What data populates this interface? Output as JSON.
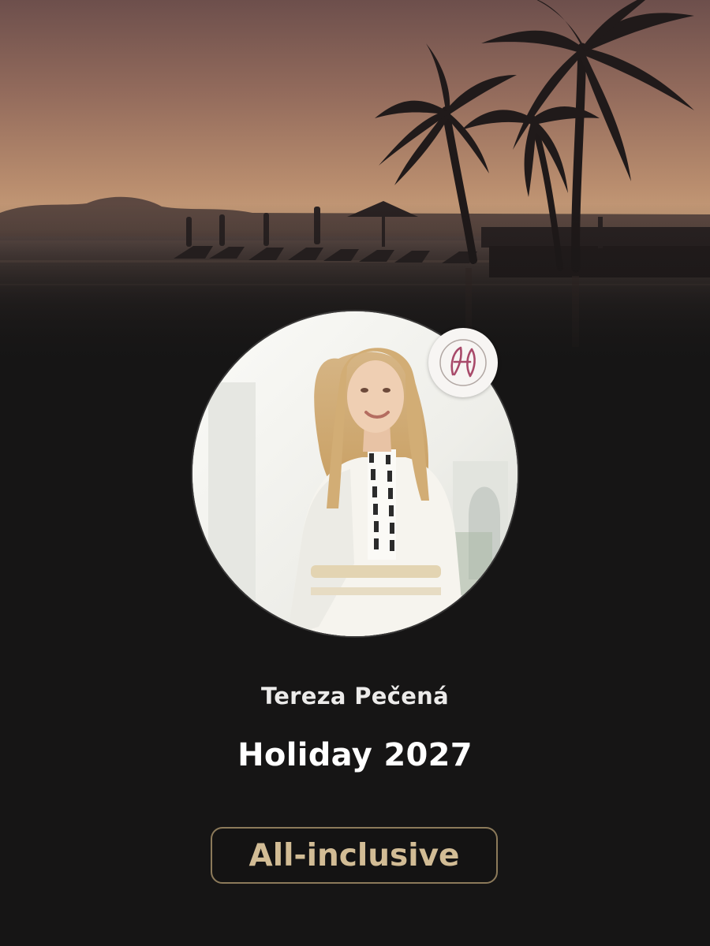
{
  "profile": {
    "name": "Tereza Pečená",
    "avatar_icon": "person-portrait-icon",
    "logo_icon": "monogram-logo-icon"
  },
  "event": {
    "title": "Holiday 2027",
    "badge": "All-inclusive"
  },
  "colors": {
    "background": "#161515",
    "accent_gold": "#d2bc95",
    "pill_border": "#8c7a5a",
    "text_primary": "#ffffff",
    "text_secondary": "#ecebea"
  },
  "cover": {
    "scene": "tropical-sunset-beach-icon"
  }
}
